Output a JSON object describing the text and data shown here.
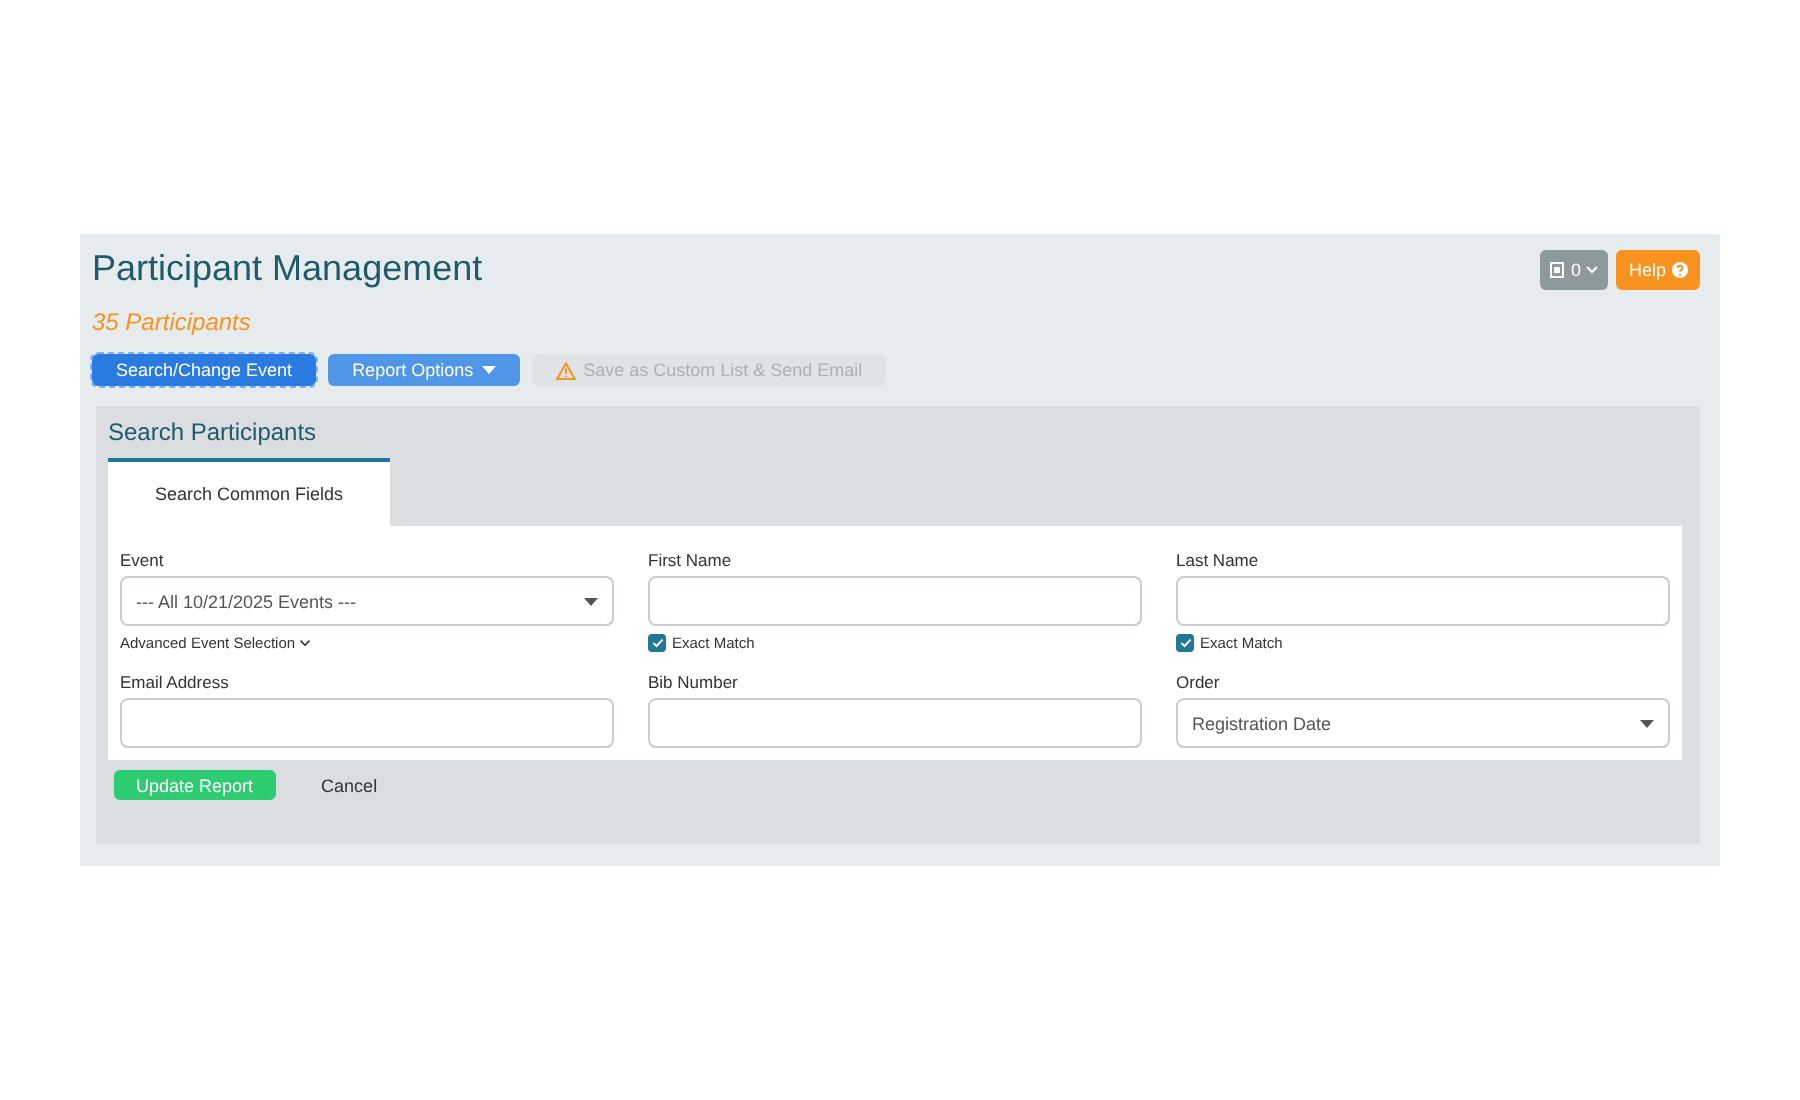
{
  "header": {
    "title": "Participant Management",
    "count": "35 Participants",
    "badge": "0",
    "help": "Help"
  },
  "toolbar": [
    {
      "label": "Search/Change Event",
      "kind": "primary",
      "disabled": false,
      "dropdown": false
    },
    {
      "label": "Report Options",
      "kind": "secondary",
      "disabled": false,
      "dropdown": true
    },
    {
      "label": "Save as Custom List & Send Email",
      "kind": "warning",
      "disabled": true,
      "dropdown": false
    }
  ],
  "search": {
    "title": "Search Participants",
    "tabs": [
      {
        "label": "Search Common Fields",
        "selected": true
      }
    ],
    "fields": [
      {
        "label": "Event",
        "kind": "select",
        "value": "--- All 10/21/2025 Events ---",
        "link": "Advanced Event Selection"
      },
      {
        "label": "First Name",
        "kind": "text",
        "exact_match": {
          "label": "Exact Match",
          "checked": true
        }
      },
      {
        "label": "Last Name",
        "kind": "text",
        "exact_match": {
          "label": "Exact Match",
          "checked": true
        }
      },
      {
        "label": "Email Address",
        "kind": "text"
      },
      {
        "label": "Bib Number",
        "kind": "text"
      },
      {
        "label": "Order",
        "kind": "select",
        "value": "Registration Date"
      }
    ],
    "buttons": [
      {
        "label": "Update Report",
        "kind": "primary"
      },
      {
        "label": "Cancel",
        "kind": "link"
      }
    ]
  }
}
